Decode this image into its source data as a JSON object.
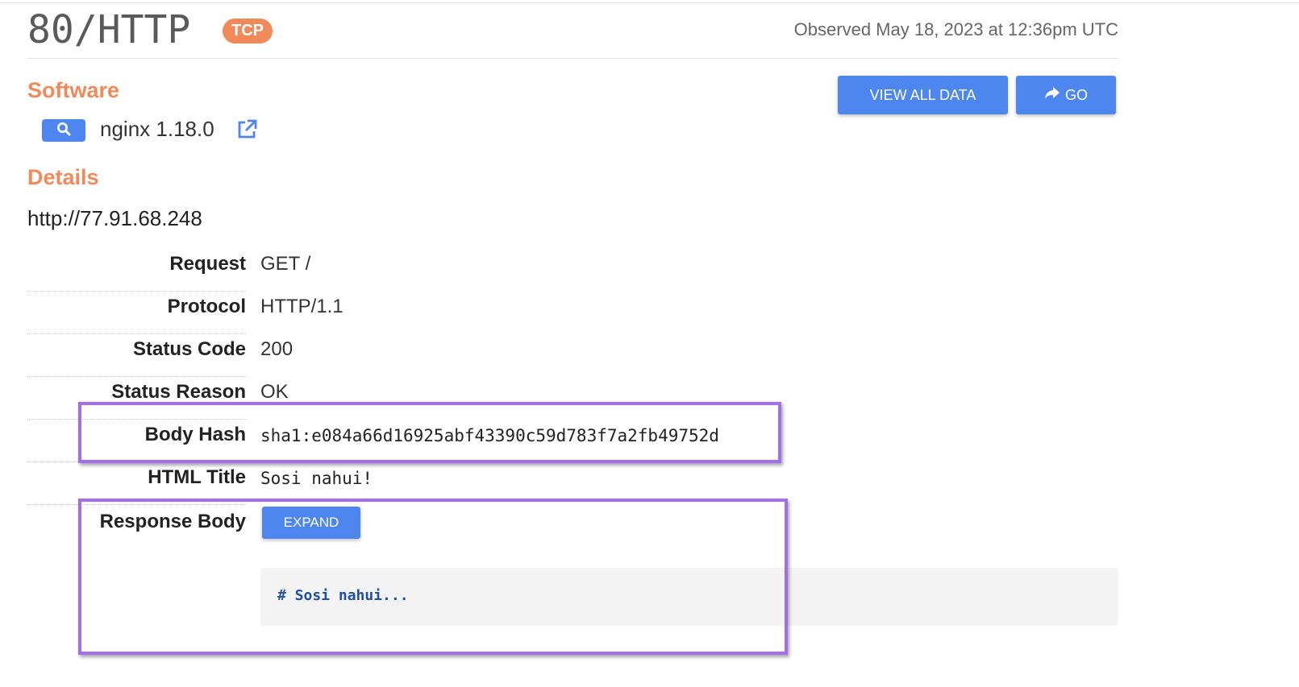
{
  "header": {
    "port": "80/HTTP",
    "transport": "TCP",
    "observed": "Observed May 18, 2023 at 12:36pm UTC"
  },
  "actions": {
    "view_all": "VIEW ALL DATA",
    "go": "GO"
  },
  "software": {
    "heading": "Software",
    "name": "nginx 1.18.0"
  },
  "details": {
    "heading": "Details",
    "url": "http://77.91.68.248",
    "rows": [
      {
        "label": "Request",
        "value": "GET /"
      },
      {
        "label": "Protocol",
        "value": "HTTP/1.1"
      },
      {
        "label": "Status Code",
        "value": "200"
      },
      {
        "label": "Status Reason",
        "value": "OK"
      },
      {
        "label": "Body Hash",
        "value": "sha1:e084a66d16925abf43390c59d783f7a2fb49752d"
      },
      {
        "label": "HTML Title",
        "value": "Sosi nahui!"
      }
    ],
    "response_body": {
      "label": "Response Body",
      "expand": "EXPAND",
      "preview": "# Sosi nahui..."
    }
  },
  "colors": {
    "accent": "#f08a5a",
    "button": "#4d86ee",
    "highlight": "#a66cf0"
  },
  "icons": {
    "search": "search-icon",
    "external": "external-link-icon",
    "share": "share-arrow-icon"
  }
}
